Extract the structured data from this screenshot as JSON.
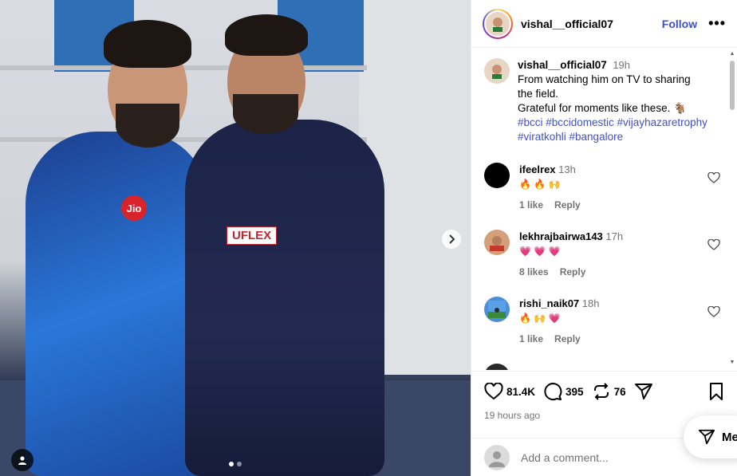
{
  "post": {
    "username": "vishal__official07",
    "follow_label": "Follow",
    "more_label": "•••",
    "caption": {
      "username": "vishal__official07",
      "time": "19h",
      "line1": "From watching him on TV to sharing",
      "line2": "the field.",
      "line3": "Grateful for moments like these. 🐐",
      "hashtags_line1": "#bcci #bccidomestic #vijayhazaretrophy",
      "hashtags_line2": "#viratkohli #bangalore"
    },
    "image": {
      "jersey_left_text": "Jio",
      "jersey_right_text": "UFLEX"
    }
  },
  "comments": [
    {
      "username": "ifeelrex",
      "time": "13h",
      "text": "🔥 🔥 🙌",
      "likes": "1 like",
      "reply": "Reply"
    },
    {
      "username": "lekhrajbairwa143",
      "time": "17h",
      "text": "💗 💗 💗",
      "likes": "8 likes",
      "reply": "Reply"
    },
    {
      "username": "rishi_naik07",
      "time": "18h",
      "text": "🔥 🙌 💗",
      "likes": "1 like",
      "reply": "Reply"
    }
  ],
  "actions": {
    "likes": "81.4K",
    "comments": "395",
    "reposts": "76",
    "posted_ago": "19 hours ago"
  },
  "add_comment": {
    "placeholder": "Add a comment..."
  },
  "messages": {
    "label": "Me"
  },
  "colors": {
    "link": "#4050c8",
    "muted": "#737373"
  }
}
